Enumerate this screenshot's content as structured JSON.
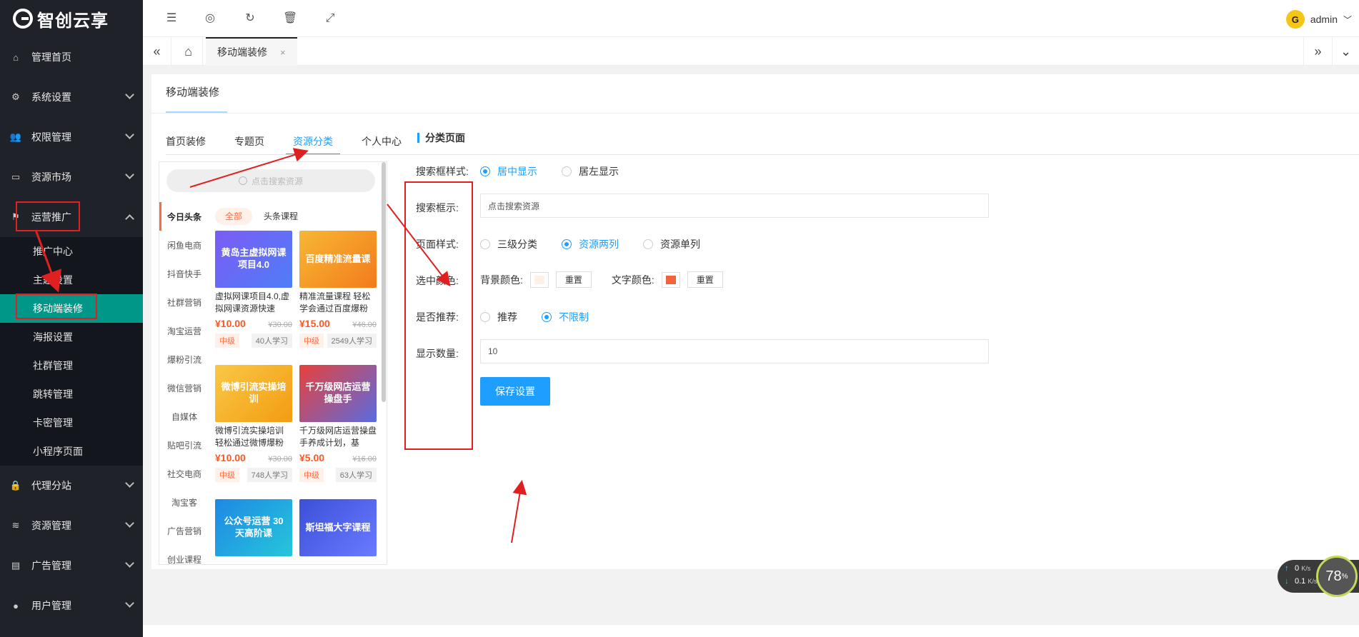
{
  "app": {
    "logo_text": "智创云享"
  },
  "sidebar": {
    "items": [
      {
        "label": "管理首页",
        "icon": "home-icon"
      },
      {
        "label": "系统设置",
        "icon": "gear-icon"
      },
      {
        "label": "权限管理",
        "icon": "users-icon"
      },
      {
        "label": "资源市场",
        "icon": "store-icon"
      },
      {
        "label": "运营推广",
        "icon": "flag-icon"
      },
      {
        "label": "代理分站",
        "icon": "lock-icon"
      },
      {
        "label": "资源管理",
        "icon": "stack-icon"
      },
      {
        "label": "广告管理",
        "icon": "ad-icon"
      },
      {
        "label": "用户管理",
        "icon": "user-icon"
      }
    ],
    "sub_items": [
      "推广中心",
      "主题设置",
      "移动端装修",
      "海报设置",
      "社群管理",
      "跳转管理",
      "卡密管理",
      "小程序页面"
    ]
  },
  "topbar": {
    "user_name": "admin",
    "avatar_letter": "G"
  },
  "tabs_row": {
    "active_tab": "移动端装修",
    "close": "×"
  },
  "card": {
    "title": "移动端装修",
    "tabs": [
      "首页装修",
      "专题页",
      "资源分类",
      "个人中心"
    ],
    "active_tab_index": 2
  },
  "preview": {
    "search_placeholder": "点击搜索资源",
    "categories": [
      "今日头条",
      "闲鱼电商",
      "抖音快手",
      "社群营销",
      "淘宝运营",
      "爆粉引流",
      "微信营销",
      "自媒体",
      "贴吧引流",
      "社交电商",
      "淘宝客",
      "广告营销",
      "创业课程"
    ],
    "chips": [
      "全部",
      "头条课程"
    ],
    "products": [
      {
        "image_text": "黄岛主虚拟网课项目4.0",
        "name": "虚拟网课项目4.0,虚拟网课资源快速",
        "price": "¥10.00",
        "old_price": "¥30.00",
        "level": "中级",
        "learners": "40人学习",
        "color": "#7b5cf5"
      },
      {
        "image_text": "百度精准流量课",
        "name": "精准流量课程 轻松学会通过百度爆粉",
        "price": "¥15.00",
        "old_price": "¥46.00",
        "level": "中级",
        "learners": "2549人学习",
        "color": "#f5a623"
      },
      {
        "image_text": "微博引流实操培训",
        "name": "微博引流实操培训 轻松通过微博爆粉",
        "price": "¥10.00",
        "old_price": "¥30.00",
        "level": "中级",
        "learners": "748人学习",
        "color": "#f7b733"
      },
      {
        "image_text": "千万级网店运营操盘手",
        "name": "千万级网店运营操盘手养成计划，基",
        "price": "¥5.00",
        "old_price": "¥16.00",
        "level": "中级",
        "learners": "63人学习",
        "color": "#e8413a"
      },
      {
        "image_text": "公众号运营 30天高阶课",
        "color": "#1e88e5"
      },
      {
        "image_text": "斯坦福大字课程",
        "color": "#3b4fd8"
      }
    ]
  },
  "form": {
    "section_title": "分类页面",
    "search_style_label": "搜索框样式:",
    "search_style_options": [
      "居中显示",
      "居左显示"
    ],
    "search_style_selected": 0,
    "search_hint_label": "搜索框示:",
    "search_hint_value": "点击搜索资源",
    "page_style_label": "页面样式:",
    "page_style_options": [
      "三级分类",
      "资源两列",
      "资源单列"
    ],
    "page_style_selected": 1,
    "color_label": "选中颜色:",
    "bg_color_label": "背景颜色:",
    "text_color_label": "文字颜色:",
    "reset_label": "重置",
    "bg_color": "#fdf1e6",
    "text_color": "#f0643c",
    "recommend_label": "是否推荐:",
    "recommend_options": [
      "推荐",
      "不限制"
    ],
    "recommend_selected": 1,
    "count_label": "显示数量:",
    "count_value": "10",
    "save_label": "保存设置"
  },
  "network": {
    "up": "0",
    "up_unit": "K/s",
    "down": "0.1",
    "down_unit": "K/s",
    "cpu": "78",
    "cpu_unit": "%"
  },
  "colors": {
    "sidebar_bg": "#20222a",
    "active_teal": "#009688",
    "accent_blue": "#1e9fff",
    "annotation_red": "#e02020",
    "price_orange": "#ff5722"
  }
}
